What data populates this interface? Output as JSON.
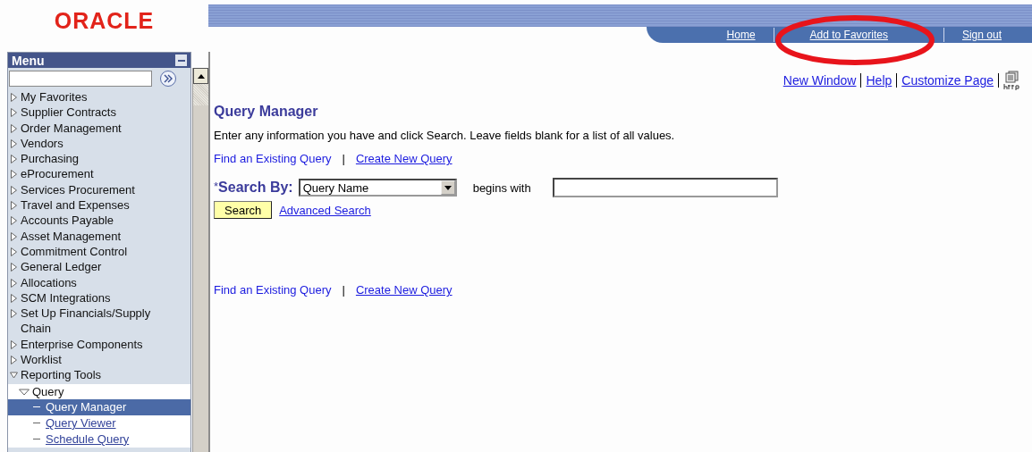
{
  "logo": "ORACLE",
  "header_links": [
    {
      "label": "Home"
    },
    {
      "label": "Add to Favorites",
      "annotated": true
    },
    {
      "label": "Sign out"
    }
  ],
  "menu": {
    "title": "Menu",
    "items": [
      {
        "label": "My Favorites",
        "expanded": false
      },
      {
        "label": "Supplier Contracts",
        "expanded": false
      },
      {
        "label": "Order Management",
        "expanded": false
      },
      {
        "label": "Vendors",
        "expanded": false
      },
      {
        "label": "Purchasing",
        "expanded": false
      },
      {
        "label": "eProcurement",
        "expanded": false
      },
      {
        "label": "Services Procurement",
        "expanded": false
      },
      {
        "label": "Travel and Expenses",
        "expanded": false
      },
      {
        "label": "Accounts Payable",
        "expanded": false
      },
      {
        "label": "Asset Management",
        "expanded": false
      },
      {
        "label": "Commitment Control",
        "expanded": false
      },
      {
        "label": "General Ledger",
        "expanded": false
      },
      {
        "label": "Allocations",
        "expanded": false
      },
      {
        "label": "SCM Integrations",
        "expanded": false
      },
      {
        "label": "Set Up Financials/Supply Chain",
        "expanded": false
      },
      {
        "label": "Enterprise Components",
        "expanded": false
      },
      {
        "label": "Worklist",
        "expanded": false
      },
      {
        "label": "Reporting Tools",
        "expanded": true,
        "children": [
          {
            "label": "Query",
            "expanded": true,
            "children": [
              {
                "label": "Query Manager",
                "selected": true
              },
              {
                "label": "Query Viewer",
                "selected": false
              },
              {
                "label": "Schedule Query",
                "selected": false
              }
            ]
          }
        ]
      }
    ]
  },
  "page_links": [
    {
      "label": "New Window"
    },
    {
      "label": "Help"
    },
    {
      "label": "Customize Page"
    }
  ],
  "page": {
    "title": "Query Manager",
    "instructions": "Enter any information you have and click Search. Leave fields blank for a list of all values.",
    "top_links": [
      {
        "label": "Find an Existing Query",
        "underlined": false
      },
      {
        "label": "Create New Query",
        "underlined": true
      }
    ],
    "search_by": {
      "required_mark": "*",
      "label": "Search By:",
      "value": "Query Name",
      "operator": "begins with"
    },
    "search_button": "Search",
    "advanced_link": "Advanced Search",
    "bottom_links": [
      {
        "label": "Find an Existing Query",
        "underlined": false
      },
      {
        "label": "Create New Query",
        "underlined": true
      }
    ],
    "separator": "|"
  }
}
